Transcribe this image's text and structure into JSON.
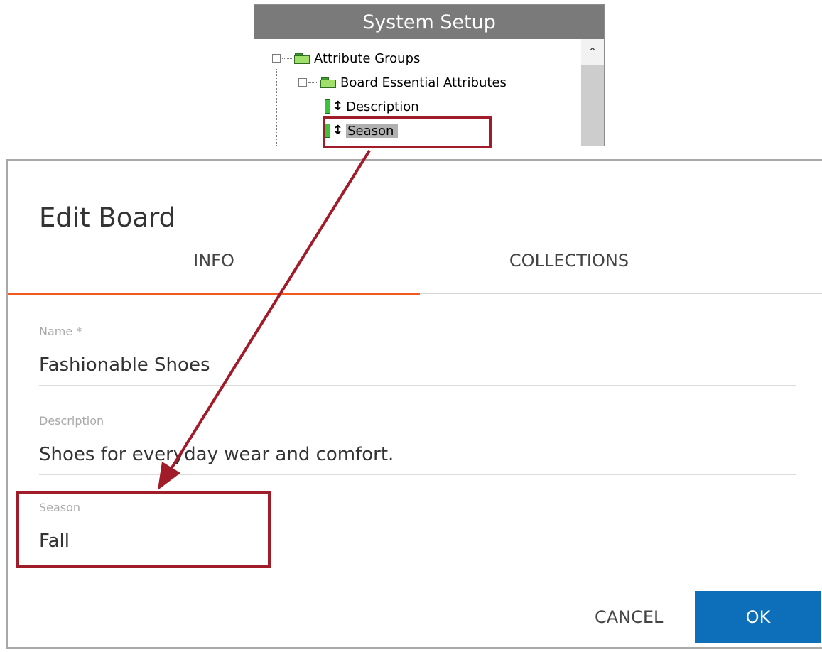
{
  "system_setup": {
    "title": "System Setup",
    "tree": {
      "root_label": "Attribute Groups",
      "group_label": "Board Essential Attributes",
      "items": [
        {
          "label": "Description",
          "selected": false
        },
        {
          "label": "Season",
          "selected": true
        }
      ]
    }
  },
  "dialog": {
    "title": "Edit Board",
    "tabs": [
      {
        "label": "INFO",
        "active": true
      },
      {
        "label": "COLLECTIONS",
        "active": false
      }
    ],
    "fields": [
      {
        "label": "Name *",
        "value": "Fashionable Shoes"
      },
      {
        "label": "Description",
        "value": "Shoes for everyday wear and comfort."
      },
      {
        "label": "Season",
        "value": "Fall"
      }
    ],
    "cancel_label": "CANCEL",
    "ok_label": "OK"
  },
  "colors": {
    "accent_tab": "#f05a22",
    "ok_button": "#0d6eb9",
    "annotation": "#a01c28",
    "tree_header": "#7a7a7a"
  },
  "icons": [
    "expand-box-icon",
    "folder-icon",
    "attribute-icon",
    "chevron-up-icon",
    "annotation-arrow"
  ]
}
